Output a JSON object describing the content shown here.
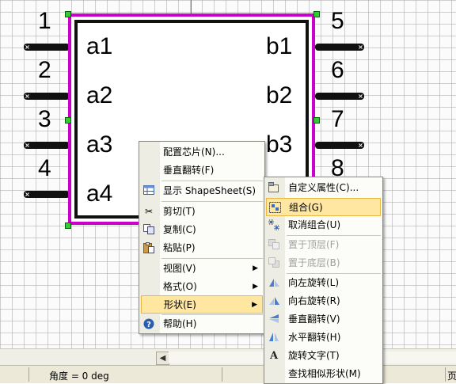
{
  "chip": {
    "left_pins": [
      "1",
      "2",
      "3",
      "4"
    ],
    "right_pins": [
      "5",
      "6",
      "7",
      "8"
    ],
    "left_labels": [
      "a1",
      "a2",
      "a3",
      "a4"
    ],
    "right_labels": [
      "b1",
      "b2",
      "b3"
    ],
    "pin_marker": "×"
  },
  "context_menu": {
    "items": [
      {
        "label": "配置芯片(N)...",
        "icon": ""
      },
      {
        "label": "垂直翻转(F)",
        "icon": ""
      },
      {
        "label": "显示 ShapeSheet(S)",
        "icon": "table-icon"
      },
      {
        "label": "剪切(T)",
        "icon": "scissors-icon"
      },
      {
        "label": "复制(C)",
        "icon": "copy-icon"
      },
      {
        "label": "粘贴(P)",
        "icon": "paste-icon"
      },
      {
        "label": "视图(V)",
        "icon": ""
      },
      {
        "label": "格式(O)",
        "icon": ""
      },
      {
        "label": "形状(E)",
        "icon": ""
      },
      {
        "label": "帮助(H)",
        "icon": "help-icon"
      }
    ]
  },
  "submenu": {
    "items": [
      {
        "label": "自定义属性(C)...",
        "icon": "custom-props-icon"
      },
      {
        "label": "组合(G)",
        "icon": "group-icon"
      },
      {
        "label": "取消组合(U)",
        "icon": "ungroup-icon"
      },
      {
        "label": "置于顶层(F)",
        "icon": "bring-front-icon"
      },
      {
        "label": "置于底层(B)",
        "icon": "send-back-icon"
      },
      {
        "label": "向左旋转(L)",
        "icon": "rotate-left-icon"
      },
      {
        "label": "向右旋转(R)",
        "icon": "rotate-right-icon"
      },
      {
        "label": "垂直翻转(V)",
        "icon": "flip-vertical-icon"
      },
      {
        "label": "水平翻转(H)",
        "icon": "flip-horizontal-icon"
      },
      {
        "label": "旋转文字(T)",
        "icon": "rotate-text-icon"
      },
      {
        "label": "查找相似形状(M)",
        "icon": "find-similar-icon"
      }
    ]
  },
  "statusbar": {
    "angle": "角度 = 0 deg",
    "page": "页"
  },
  "colors": {
    "highlight": "#ffe7a2",
    "chip_outline": "#cc00cc"
  }
}
